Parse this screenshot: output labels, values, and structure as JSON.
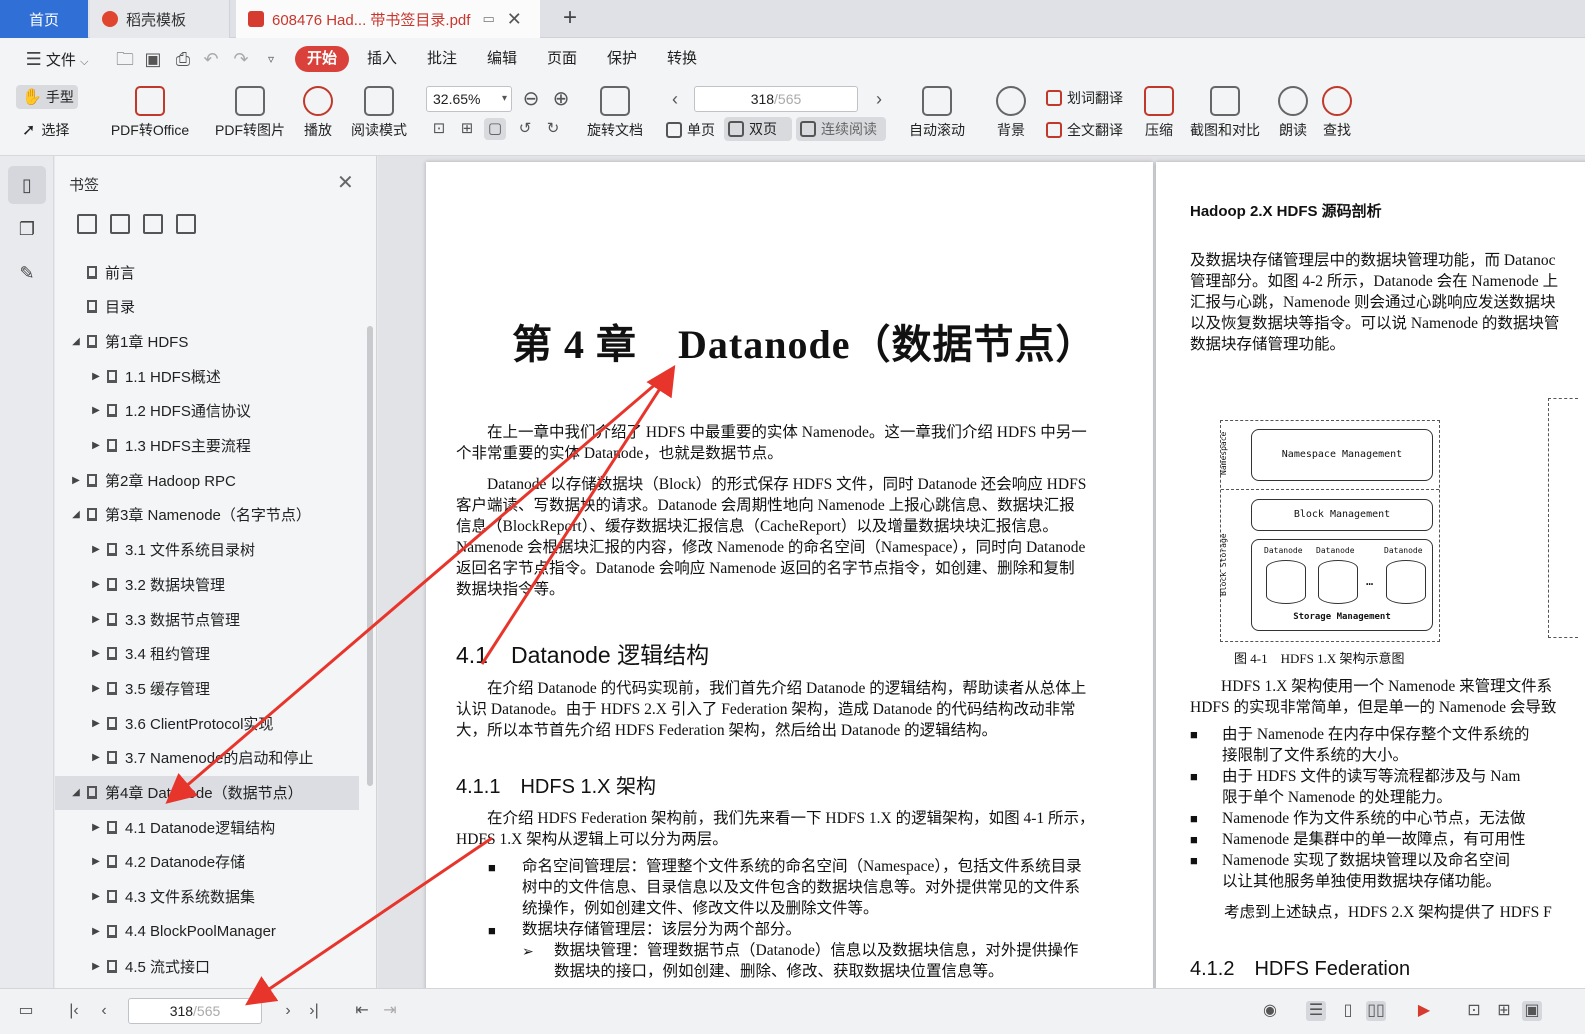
{
  "tabs": {
    "home": "首页",
    "template": "稻壳模板",
    "document": "608476 Had... 带书签目录.pdf"
  },
  "menu": {
    "file": "文件",
    "items": [
      "开始",
      "插入",
      "批注",
      "编辑",
      "页面",
      "保护",
      "转换"
    ]
  },
  "ribbon": {
    "hand": "手型",
    "select": "选择",
    "pdf_to_office": "PDF转Office",
    "pdf_to_image": "PDF转图片",
    "play": "播放",
    "read_mode": "阅读模式",
    "zoom": "32.65%",
    "rotate": "旋转文档",
    "page_current": "318",
    "page_total": "/565",
    "single": "单页",
    "double": "双页",
    "continuous": "连续阅读",
    "autoscroll": "自动滚动",
    "background": "背景",
    "word_translate": "划词翻译",
    "full_translate": "全文翻译",
    "compress": "压缩",
    "screenshot": "截图和对比",
    "read_aloud": "朗读",
    "find": "查找"
  },
  "sidebar": {
    "title": "书签",
    "bookmarks": [
      {
        "label": "前言",
        "level": 0,
        "arrow": ""
      },
      {
        "label": "目录",
        "level": 0,
        "arrow": ""
      },
      {
        "label": "第1章 HDFS",
        "level": 0,
        "arrow": "◢"
      },
      {
        "label": "1.1 HDFS概述",
        "level": 1,
        "arrow": "▶"
      },
      {
        "label": "1.2 HDFS通信协议",
        "level": 1,
        "arrow": "▶"
      },
      {
        "label": "1.3 HDFS主要流程",
        "level": 1,
        "arrow": "▶"
      },
      {
        "label": "第2章 Hadoop RPC",
        "level": 0,
        "arrow": "▶"
      },
      {
        "label": "第3章 Namenode（名字节点）",
        "level": 0,
        "arrow": "◢"
      },
      {
        "label": "3.1 文件系统目录树",
        "level": 1,
        "arrow": "▶"
      },
      {
        "label": "3.2 数据块管理",
        "level": 1,
        "arrow": "▶"
      },
      {
        "label": "3.3 数据节点管理",
        "level": 1,
        "arrow": "▶"
      },
      {
        "label": "3.4 租约管理",
        "level": 1,
        "arrow": "▶"
      },
      {
        "label": "3.5 缓存管理",
        "level": 1,
        "arrow": "▶"
      },
      {
        "label": "3.6 ClientProtocol实现",
        "level": 1,
        "arrow": "▶"
      },
      {
        "label": "3.7 Namenode的启动和停止",
        "level": 1,
        "arrow": "▶"
      },
      {
        "label": "第4章 Datanode（数据节点）",
        "level": 0,
        "arrow": "◢",
        "active": true
      },
      {
        "label": "4.1 Datanode逻辑结构",
        "level": 1,
        "arrow": "▶"
      },
      {
        "label": "4.2 Datanode存储",
        "level": 1,
        "arrow": "▶"
      },
      {
        "label": "4.3 文件系统数据集",
        "level": 1,
        "arrow": "▶"
      },
      {
        "label": "4.4 BlockPoolManager",
        "level": 1,
        "arrow": "▶"
      },
      {
        "label": "4.5 流式接口",
        "level": 1,
        "arrow": "▶"
      }
    ]
  },
  "page_left": {
    "chapter_title": "第 4 章　Datanode（数据节点）",
    "para1": [
      "在上一章中我们介绍了 HDFS 中最重要的实体 Namenode。这一章我们介绍 HDFS 中另一",
      "个非常重要的实体 Datanode，也就是数据节点。"
    ],
    "para2": [
      "Datanode 以存储数据块（Block）的形式保存 HDFS 文件，同时 Datanode 还会响应 HDFS",
      "客户端读、写数据块的请求。Datanode 会周期性地向 Namenode 上报心跳信息、数据块汇报",
      "信息（BlockReport）、缓存数据块汇报信息（CacheReport）以及增量数据块块汇报信息。",
      "Namenode 会根据块汇报的内容，修改 Namenode 的命名空间（Namespace），同时向 Datanode",
      "返回名字节点指令。Datanode 会响应 Namenode 返回的名字节点指令，如创建、删除和复制",
      "数据块指令等。"
    ],
    "section_41": "4.1　Datanode 逻辑结构",
    "para3": [
      "在介绍 Datanode 的代码实现前，我们首先介绍 Datanode 的逻辑结构，帮助读者从总体上",
      "认识 Datanode。由于 HDFS 2.X 引入了 Federation 架构，造成 Datanode 的代码结构改动非常",
      "大，所以本节首先介绍 HDFS Federation 架构，然后给出 Datanode 的逻辑结构。"
    ],
    "section_411": "4.1.1　HDFS 1.X 架构",
    "para4": [
      "在介绍 HDFS Federation 架构前，我们先来看一下 HDFS 1.X 的逻辑架构，如图 4-1 所示，",
      "HDFS 1.X 架构从逻辑上可以分为两层。"
    ],
    "bullet1": [
      "命名空间管理层：管理整个文件系统的命名空间（Namespace），包括文件系统目录",
      "树中的文件信息、目录信息以及文件包含的数据块信息等。对外提供常见的文件系",
      "统操作，例如创建文件、修改文件以及删除文件等。"
    ],
    "bullet2": "数据块存储管理层：该层分为两个部分。",
    "sub1": [
      "数据块管理：管理数据节点（Datanode）信息以及数据块信息，对外提供操作",
      "数据块的接口，例如创建、删除、修改、获取数据块位置信息等。"
    ]
  },
  "page_right": {
    "header": "Hadoop 2.X HDFS 源码剖析",
    "para1": [
      "及数据块存储管理层中的数据块管理功能，而 Datanoc",
      "管理部分。如图 4-2 所示，Datanode 会在 Namenode 上",
      "汇报与心跳，Namenode 则会通过心跳响应发送数据块",
      "以及恢复数据块等指令。可以说 Namenode 的数据块管",
      "数据块存储管理功能。"
    ],
    "diagram": {
      "namespace_label": "Namespace",
      "block_storage_label": "Block Storage",
      "namespace_mgmt": "Namespace Management",
      "block_mgmt": "Block Management",
      "datanode1": "Datanode",
      "datanode2": "Datanode",
      "datanode3": "Datanode",
      "ellipsis": "…",
      "storage_mgmt": "Storage Management"
    },
    "figure_caption": "图 4-1　HDFS 1.X 架构示意图",
    "para2": [
      "HDFS 1.X 架构使用一个 Namenode 来管理文件系",
      "HDFS 的实现非常简单，但是单一的 Namenode 会导致"
    ],
    "bullets": [
      [
        "由于 Namenode 在内存中保存整个文件系统的",
        "接限制了文件系统的大小。"
      ],
      [
        "由于 HDFS 文件的读写等流程都涉及与 Nam",
        "限于单个 Namenode 的处理能力。"
      ],
      [
        "Namenode 作为文件系统的中心节点，无法做"
      ],
      [
        "Namenode 是集群中的单一故障点，有可用性"
      ],
      [
        "Namenode 实现了数据块管理以及命名空间",
        "以让其他服务单独使用数据块存储功能。"
      ]
    ],
    "para3": "考虑到上述缺点，HDFS 2.X 架构提供了 HDFS F",
    "section_412": "4.1.2　HDFS Federation"
  },
  "statusbar": {
    "page_current": "318",
    "page_total": "/565"
  },
  "colors": {
    "accent_blue": "#2f6fd6",
    "accent_red": "#d9413a",
    "arrow_red": "#e8352c"
  }
}
